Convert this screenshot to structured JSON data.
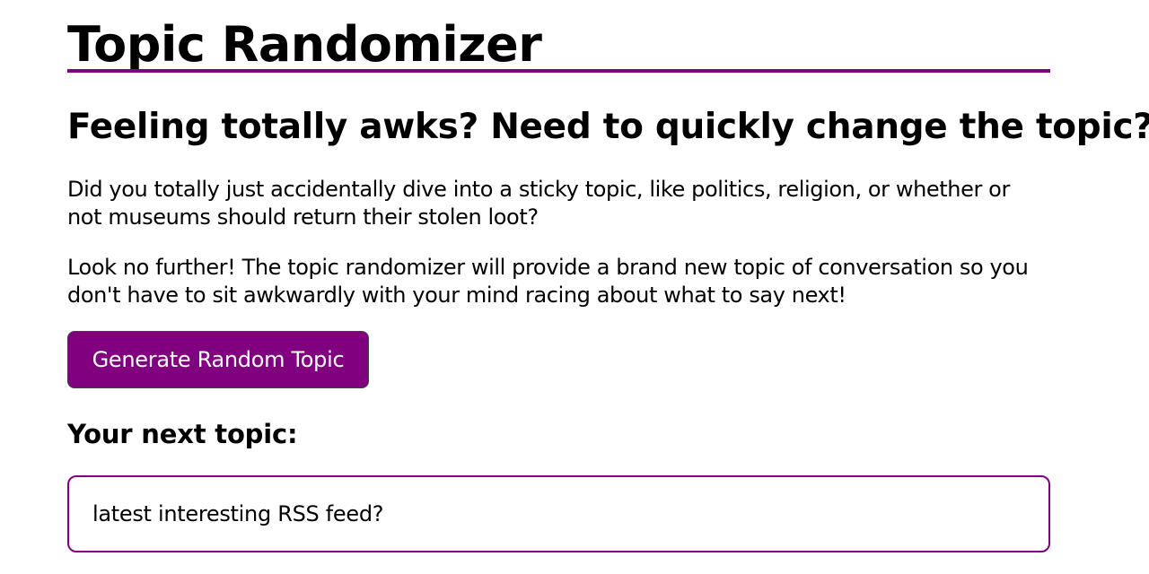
{
  "header": {
    "title": "Topic Randomizer"
  },
  "intro": {
    "subtitle": "Feeling totally awks? Need to quickly change the topic?",
    "paragraph_1": "Did you totally just accidentally dive into a sticky topic, like politics, religion, or whether or not museums should return their stolen loot?",
    "paragraph_2": "Look no further! The topic randomizer will provide a brand new topic of conversation so you don't have to sit awkwardly with your mind racing about what to say next!"
  },
  "generator": {
    "button_label": "Generate Random Topic",
    "result_label": "Your next topic:",
    "result_value": "latest interesting RSS feed?"
  },
  "colors": {
    "accent": "#800080",
    "background": "#ffffff",
    "text": "#000000",
    "button_text": "#ffffff"
  }
}
